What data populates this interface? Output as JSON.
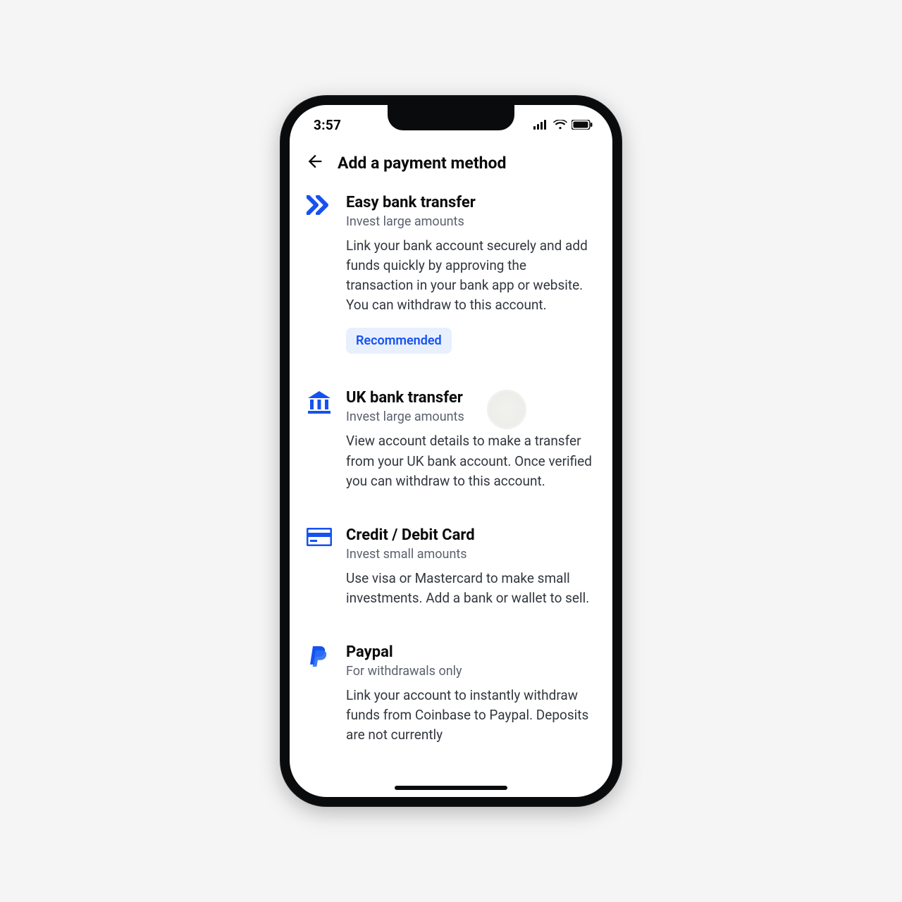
{
  "status": {
    "time": "3:57"
  },
  "header": {
    "title": "Add a payment method"
  },
  "items": [
    {
      "title": "Easy bank transfer",
      "subtitle": "Invest large amounts",
      "description": "Link your bank account securely and add funds quickly by approving the transaction in your bank app or website. You can withdraw to this account.",
      "badge": "Recommended"
    },
    {
      "title": "UK bank transfer",
      "subtitle": "Invest large amounts",
      "description": "View account details to make a transfer from your UK bank account. Once verified you can withdraw to this account."
    },
    {
      "title": "Credit / Debit Card",
      "subtitle": "Invest small amounts",
      "description": "Use visa or Mastercard to make small investments. Add a bank or wallet to sell."
    },
    {
      "title": "Paypal",
      "subtitle": "For withdrawals only",
      "description": "Link your account to instantly withdraw funds from Coinbase to Paypal. Deposits are not currently"
    }
  ]
}
